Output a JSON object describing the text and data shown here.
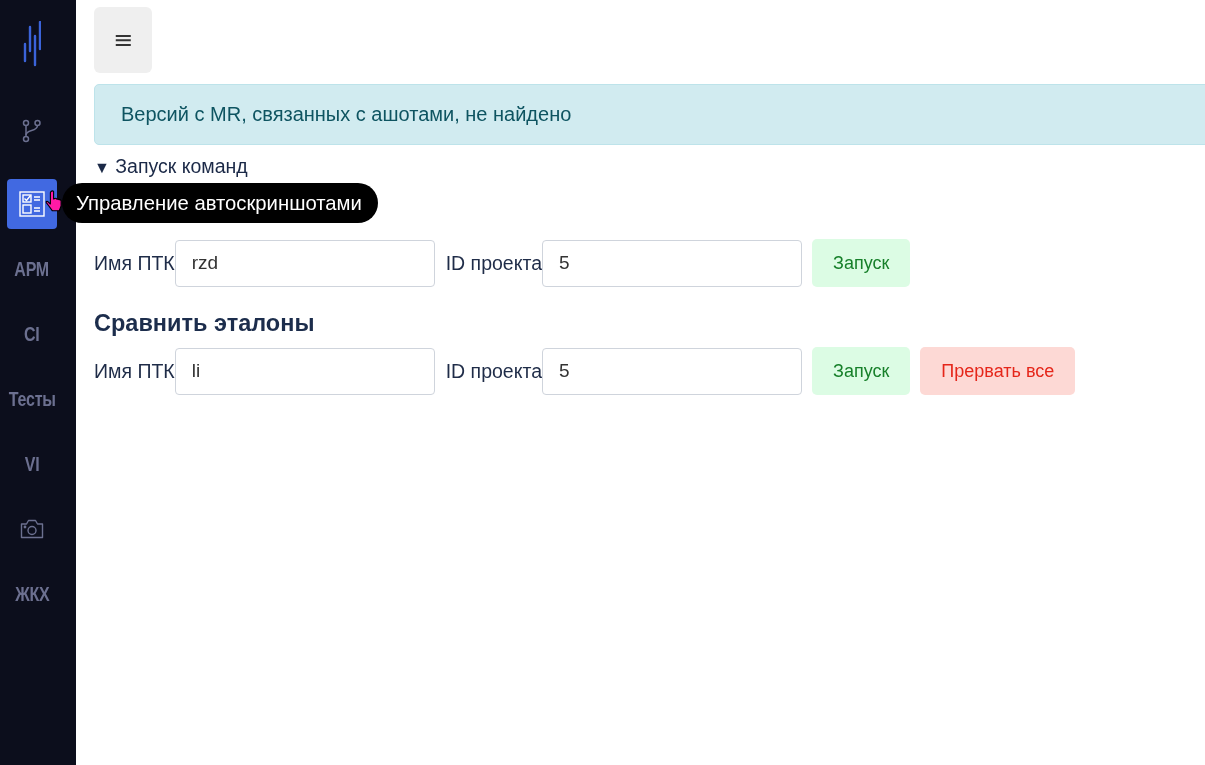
{
  "sidebar": {
    "items": [
      {
        "kind": "branch",
        "selected": false
      },
      {
        "kind": "checklist",
        "selected": true
      },
      {
        "kind": "label",
        "label": "АРМ",
        "selected": false
      },
      {
        "kind": "label",
        "label": "CI",
        "selected": false
      },
      {
        "kind": "label",
        "label": "Тесты",
        "selected": false
      },
      {
        "kind": "label",
        "label": "VI",
        "selected": false
      },
      {
        "kind": "camera",
        "selected": false
      },
      {
        "kind": "label",
        "label": "ЖКХ",
        "selected": false
      }
    ]
  },
  "tooltip": "Управление автоскриншотами",
  "menu_button": "≡",
  "alert": "Версий с MR, связанных с ашотами, не найдено",
  "commands": {
    "marker": "▼",
    "summary": "Запуск команд",
    "expanded": true,
    "forms": [
      {
        "fields": [
          {
            "label": "Имя ПТК",
            "value": "rzd"
          },
          {
            "label": "ID проекта",
            "value": "5"
          }
        ],
        "buttons": [
          {
            "label": "Запуск",
            "kind": "start"
          }
        ]
      },
      {
        "title": "Сравнить эталоны",
        "fields": [
          {
            "label": "Имя ПТК",
            "value": "li"
          },
          {
            "label": "ID проекта",
            "value": "5"
          }
        ],
        "buttons": [
          {
            "label": "Запуск",
            "kind": "start"
          },
          {
            "label": "Прервать все",
            "kind": "stop"
          }
        ]
      }
    ]
  }
}
